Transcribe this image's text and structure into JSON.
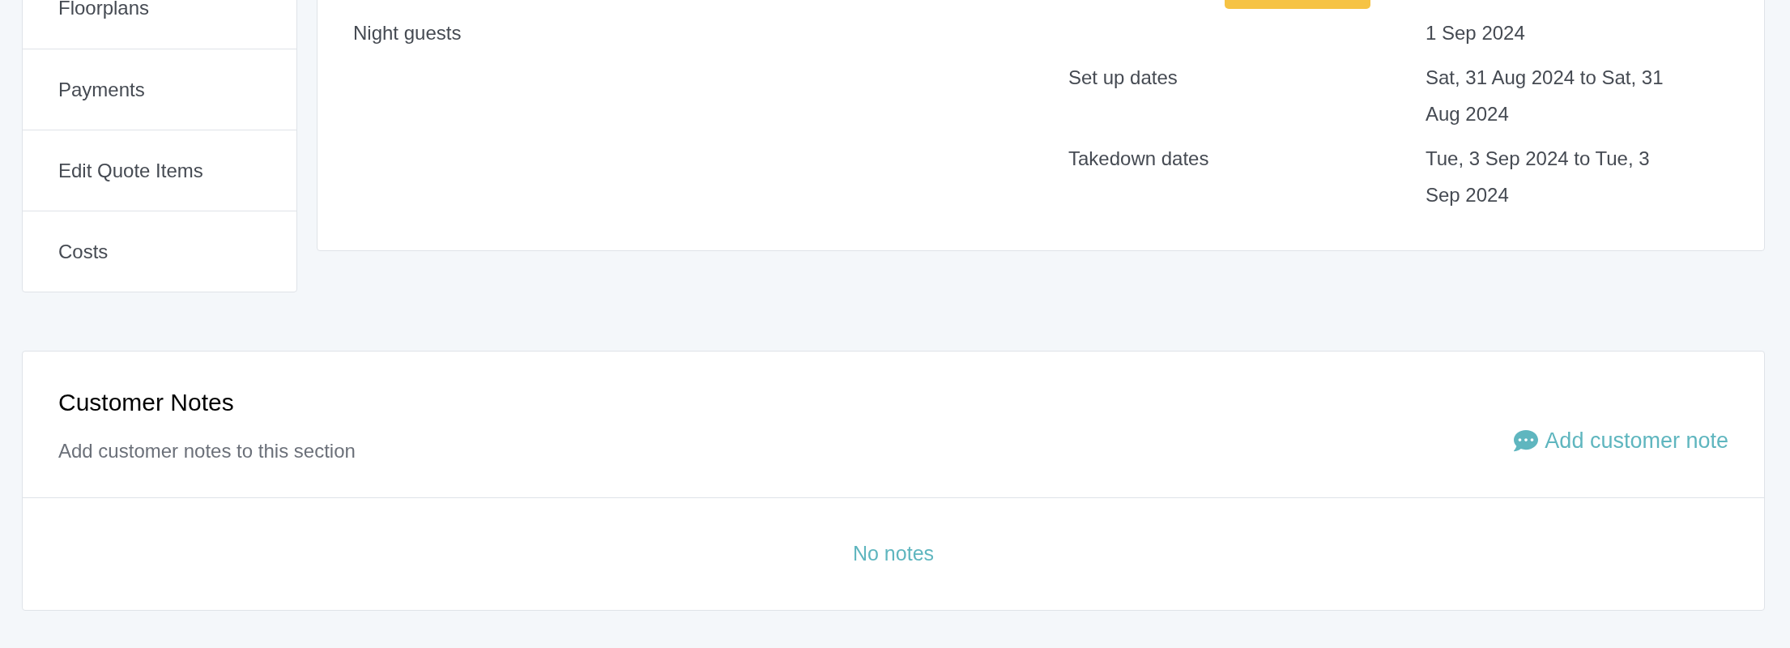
{
  "sidebar": {
    "items": [
      {
        "label": "Floorplans"
      },
      {
        "label": "Payments"
      },
      {
        "label": "Edit Quote Items"
      },
      {
        "label": "Costs"
      }
    ]
  },
  "details": {
    "guests": [
      "Night guests"
    ],
    "dates": [
      {
        "badge": true,
        "value": "1 Sep 2024"
      },
      {
        "label": "Set up dates",
        "value": "Sat, 31 Aug 2024 to Sat, 31 Aug 2024"
      },
      {
        "label": "Takedown dates",
        "value": "Tue, 3 Sep 2024 to Tue, 3 Sep 2024"
      }
    ]
  },
  "customer_notes": {
    "title": "Customer Notes",
    "subtitle": "Add customer notes to this section",
    "add_button": "Add customer note",
    "empty": "No notes"
  }
}
